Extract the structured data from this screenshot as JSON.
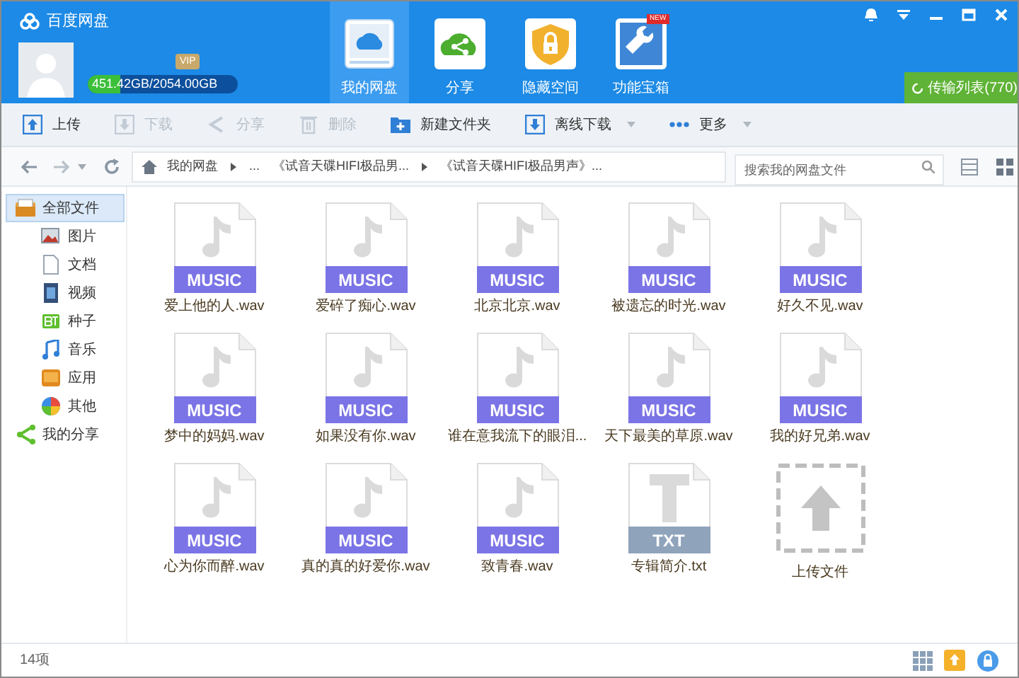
{
  "header": {
    "app_title": "百度网盘",
    "storage": {
      "text": "451.42GB/2054.00GB",
      "level": 0.22
    },
    "vip_badge": "VIP",
    "nav_tabs": [
      {
        "label": "我的网盘",
        "selected": true
      },
      {
        "label": "分享",
        "selected": false
      },
      {
        "label": "隐藏空间",
        "selected": false
      },
      {
        "label": "功能宝箱",
        "selected": false,
        "badge": "NEW"
      }
    ],
    "transfer_button": "传输列表(770)"
  },
  "toolbar": [
    {
      "label": "上传",
      "disabled": false,
      "dropdown": false
    },
    {
      "label": "下载",
      "disabled": true,
      "dropdown": false
    },
    {
      "label": "分享",
      "disabled": true,
      "dropdown": false
    },
    {
      "label": "删除",
      "disabled": true,
      "dropdown": false
    },
    {
      "label": "新建文件夹",
      "disabled": false,
      "dropdown": false
    },
    {
      "label": "离线下载",
      "disabled": false,
      "dropdown": true
    },
    {
      "label": "更多",
      "disabled": false,
      "dropdown": true
    }
  ],
  "breadcrumb": [
    "我的网盘",
    "...",
    "《试音天碟HIFI极品男...",
    "《试音天碟HIFI极品男声》..."
  ],
  "search": {
    "placeholder": "搜索我的网盘文件"
  },
  "sidebar": {
    "items": [
      {
        "label": "全部文件",
        "selected": true,
        "children": [
          {
            "label": "图片",
            "selected": false
          },
          {
            "label": "文档",
            "selected": false
          },
          {
            "label": "视频",
            "selected": false
          },
          {
            "label": "种子",
            "selected": false
          },
          {
            "label": "音乐",
            "selected": false
          },
          {
            "label": "应用",
            "selected": false
          },
          {
            "label": "其他",
            "selected": false
          }
        ]
      },
      {
        "label": "我的分享",
        "selected": false
      }
    ]
  },
  "files": [
    {
      "kind": "music",
      "type_label": "MUSIC",
      "name": "爱上他的人.wav"
    },
    {
      "kind": "music",
      "type_label": "MUSIC",
      "name": "爱碎了痴心.wav"
    },
    {
      "kind": "music",
      "type_label": "MUSIC",
      "name": "北京北京.wav"
    },
    {
      "kind": "music",
      "type_label": "MUSIC",
      "name": "被遗忘的时光.wav"
    },
    {
      "kind": "music",
      "type_label": "MUSIC",
      "name": "好久不见.wav"
    },
    {
      "kind": "music",
      "type_label": "MUSIC",
      "name": "梦中的妈妈.wav"
    },
    {
      "kind": "music",
      "type_label": "MUSIC",
      "name": "如果没有你.wav"
    },
    {
      "kind": "music",
      "type_label": "MUSIC",
      "name": "谁在意我流下的眼泪..."
    },
    {
      "kind": "music",
      "type_label": "MUSIC",
      "name": "天下最美的草原.wav"
    },
    {
      "kind": "music",
      "type_label": "MUSIC",
      "name": "我的好兄弟.wav"
    },
    {
      "kind": "music",
      "type_label": "MUSIC",
      "name": "心为你而醉.wav"
    },
    {
      "kind": "music",
      "type_label": "MUSIC",
      "name": "真的真的好爱你.wav"
    },
    {
      "kind": "music",
      "type_label": "MUSIC",
      "name": "致青春.wav"
    },
    {
      "kind": "text",
      "type_label": "TXT",
      "name": "专辑简介.txt"
    },
    {
      "kind": "upload",
      "name": "上传文件"
    }
  ],
  "status_bar": {
    "count": "14项"
  }
}
